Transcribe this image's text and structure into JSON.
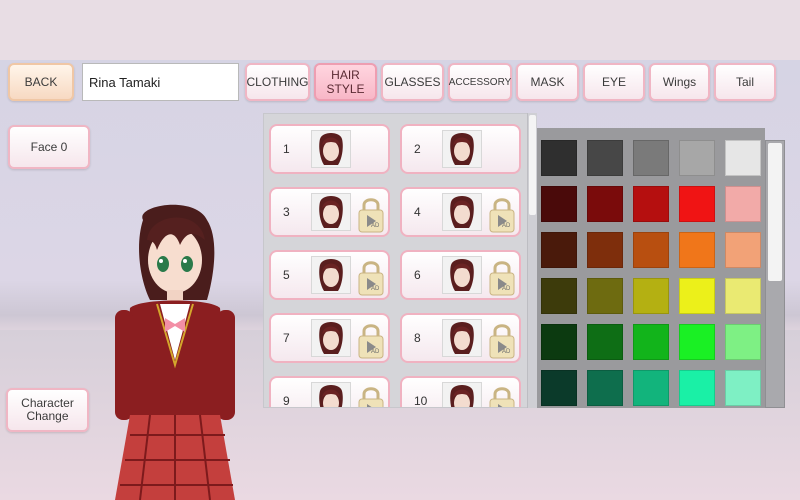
{
  "toolbar": {
    "back_label": "BACK",
    "name_value": "Rina Tamaki",
    "tabs": [
      {
        "label": "CLOTHING"
      },
      {
        "label": "HAIR\nSTYLE",
        "active": true
      },
      {
        "label": "GLASSES"
      },
      {
        "label": "ACCESSORY"
      },
      {
        "label": "MASK"
      },
      {
        "label": "EYE"
      },
      {
        "label": "Wings"
      },
      {
        "label": "Tail"
      }
    ]
  },
  "side": {
    "face_label": "Face 0",
    "character_change_label": "Character\nChange"
  },
  "hair_list": {
    "items": [
      {
        "number": "1",
        "locked": false
      },
      {
        "number": "2",
        "locked": false
      },
      {
        "number": "3",
        "locked": true,
        "lock_badge": "AD"
      },
      {
        "number": "4",
        "locked": true,
        "lock_badge": "AD"
      },
      {
        "number": "5",
        "locked": true,
        "lock_badge": "AD"
      },
      {
        "number": "6",
        "locked": true,
        "lock_badge": "AD"
      },
      {
        "number": "7",
        "locked": true,
        "lock_badge": "AD"
      },
      {
        "number": "8",
        "locked": true,
        "lock_badge": "AD"
      },
      {
        "number": "9",
        "locked": true,
        "lock_badge": "AD"
      },
      {
        "number": "10",
        "locked": true,
        "lock_badge": "AD"
      }
    ]
  },
  "color_palette": {
    "rows": [
      [
        "#2f2f2f",
        "#474747",
        "#7a7a7a",
        "#a7a7a7",
        "#e6e6e6"
      ],
      [
        "#4a0a0a",
        "#7a0b0b",
        "#b50f0f",
        "#f01414",
        "#f2aaa8"
      ],
      [
        "#4a1a0b",
        "#7e2e0c",
        "#b84f10",
        "#f0761a",
        "#f2a277"
      ],
      [
        "#3d3b0b",
        "#6e6b10",
        "#b4b012",
        "#ecf01a",
        "#eaea72"
      ],
      [
        "#0c3a10",
        "#0e6e15",
        "#12b41b",
        "#1af024",
        "#7ef084"
      ],
      [
        "#0b3a2a",
        "#0e6e4d",
        "#12b47c",
        "#1af0a6",
        "#7ef0c4"
      ]
    ]
  }
}
